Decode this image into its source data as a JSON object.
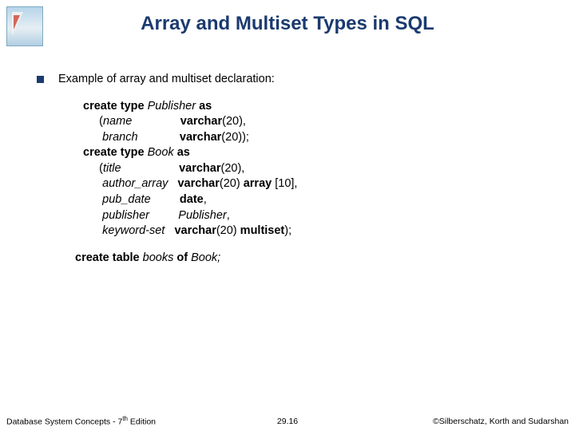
{
  "title": "Array and Multiset Types in SQL",
  "bullet1": "Example of array and multiset declaration:",
  "code": {
    "l1a": "create type ",
    "l1b": "Publisher ",
    "l1c": "as",
    "l2a": "     (",
    "l2b": "name",
    "l2c": "               ",
    "l2d": "varchar",
    "l2e": "(20),",
    "l3a": "      ",
    "l3b": "branch",
    "l3c": "             ",
    "l3d": "varchar",
    "l3e": "(20));",
    "l4a": "create type ",
    "l4b": "Book ",
    "l4c": "as",
    "l5a": "     (",
    "l5b": "title",
    "l5c": "                  ",
    "l5d": "varchar",
    "l5e": "(20),",
    "l6a": "      ",
    "l6b": "author_array",
    "l6c": "   ",
    "l6d": "varchar",
    "l6e": "(20) ",
    "l6f": "array ",
    "l6g": "[10],",
    "l7a": "      ",
    "l7b": "pub_date",
    "l7c": "         ",
    "l7d": "date",
    "l7e": ",",
    "l8a": "      ",
    "l8b": "publisher",
    "l8c": "         ",
    "l8d": "Publisher",
    "l8e": ",",
    "l9a": "      ",
    "l9b": "keyword-set",
    "l9c": "   ",
    "l9d": "varchar",
    "l9e": "(20) ",
    "l9f": "multiset",
    "l9g": ");"
  },
  "code2": {
    "a": "create table ",
    "b": "books ",
    "c": "of ",
    "d": "Book;"
  },
  "footer": {
    "left_a": "Database System Concepts - 7",
    "left_b": "th",
    "left_c": " Edition",
    "center": "29.16",
    "right": "©Silberschatz, Korth and Sudarshan"
  }
}
